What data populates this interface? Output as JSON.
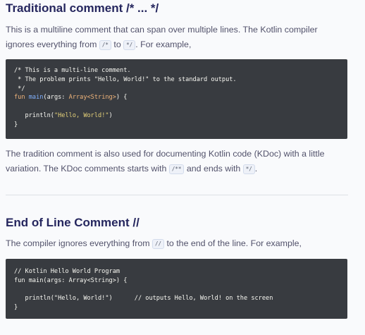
{
  "section1": {
    "heading": "Traditional comment /* ... */",
    "para1": {
      "text_before": "This is a multiline comment that can span over multiple lines. The Kotlin compiler ignores everything from ",
      "code1": "/*",
      "text_mid": " to ",
      "code2": "*/",
      "text_after": ". For example,"
    },
    "code_block": {
      "line1": "/* This is a multi-line comment.",
      "line2": " * The problem prints \"Hello, World!\" to the standard output.",
      "line3": " */",
      "line4_kw": "fun",
      "line4_fn": "main",
      "line4_args": "(args: ",
      "line4_type": "Array<String>",
      "line4_end": ") {",
      "line6_fn": "println(",
      "line6_str": "\"Hello, World!\"",
      "line6_end": ")",
      "line7": "}"
    },
    "para2": {
      "text_before": "The tradition comment is also used for documenting Kotlin code (KDoc) with a little variation. The KDoc comments starts with ",
      "code1": "/**",
      "text_mid": " and ends with ",
      "code2": "*/",
      "text_after": "."
    }
  },
  "section2": {
    "heading": "End of Line Comment //",
    "para1": {
      "text_before": "The compiler ignores everything from ",
      "code1": "//",
      "text_after": " to the end of the line. For example,"
    },
    "code_block": {
      "line1": "// Kotlin Hello World Program",
      "line2": "fun main(args: Array<String>) {",
      "line4_code": "println(\"Hello, World!\")",
      "line4_comment": "// outputs Hello, World! on the screen",
      "line5": "}"
    }
  }
}
